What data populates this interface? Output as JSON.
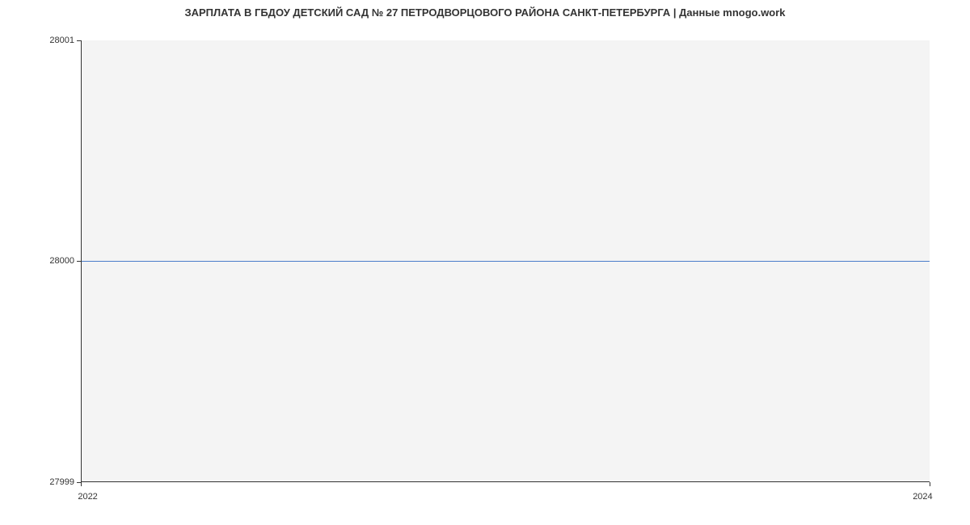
{
  "chart_data": {
    "type": "line",
    "title": "ЗАРПЛАТА В ГБДОУ ДЕТСКИЙ САД № 27 ПЕТРОДВОРЦОВОГО РАЙОНА САНКТ-ПЕТЕРБУРГА | Данные mnogo.work",
    "x": [
      2022,
      2024
    ],
    "values": [
      28000,
      28000
    ],
    "xlabel": "",
    "ylabel": "",
    "x_ticks": [
      "2022",
      "2024"
    ],
    "y_ticks": [
      "27999",
      "28000",
      "28001"
    ],
    "xlim": [
      2022,
      2024
    ],
    "ylim": [
      27999,
      28001
    ],
    "line_color": "#4a7dc9"
  }
}
